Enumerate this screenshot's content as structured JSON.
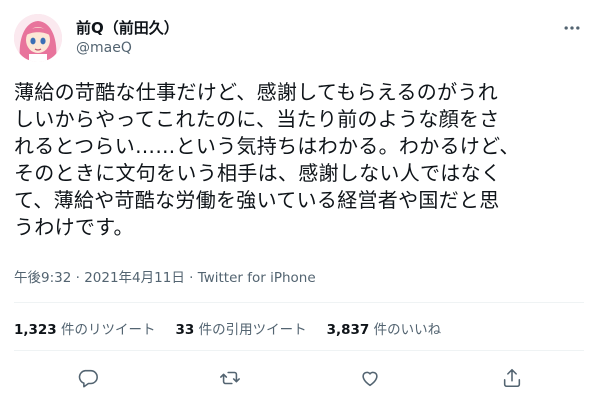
{
  "author": {
    "display_name": "前Q（前田久）",
    "handle": "@maeQ"
  },
  "tweet": {
    "text": "薄給の苛酷な仕事だけど、感謝してもらえるのがうれ\nしいからやってこれたのに、当たり前のような顔をさ\nれるとつらい……という気持ちはわかる。わかるけど、\nそのときに文句をいう相手は、感謝しない人ではなく\nて、薄給や苛酷な労働を強いている経営者や国だと思\nうわけです。",
    "time": "午後9:32",
    "date": "2021年4月11日",
    "separator": " · ",
    "source": "Twitter for iPhone"
  },
  "stats": {
    "retweets_count": "1,323",
    "retweets_label": " 件のリツイート",
    "quotes_count": "33",
    "quotes_label": " 件の引用ツイート",
    "likes_count": "3,837",
    "likes_label": " 件のいいね"
  },
  "icons": {
    "more": "more-icon",
    "reply": "reply-icon",
    "retweet": "retweet-icon",
    "like": "like-icon",
    "share": "share-icon"
  },
  "colors": {
    "text": "#0f1419",
    "secondary": "#536471",
    "divider": "#eff3f4",
    "avatar_hair": "#e8749c"
  }
}
